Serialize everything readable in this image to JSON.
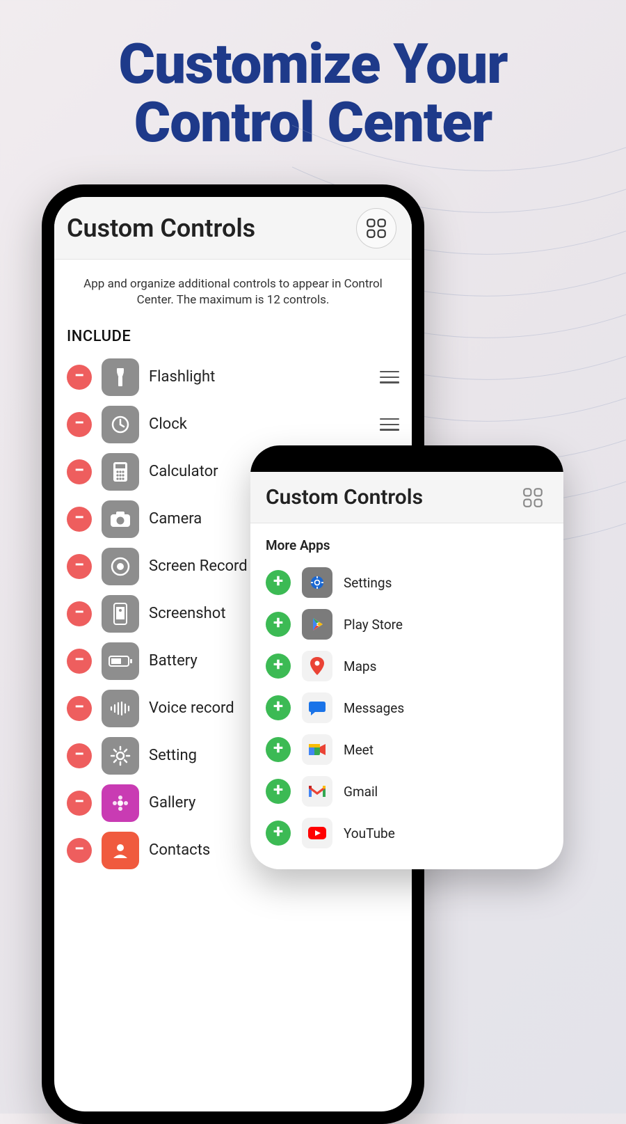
{
  "headline_line1": "Customize Your",
  "headline_line2": "Control Center",
  "phone": {
    "title": "Custom Controls",
    "description": "App and organize additional controls to appear in Control Center. The maximum is 12 controls.",
    "include_label": "INCLUDE",
    "items": [
      {
        "label": "Flashlight",
        "icon": "flashlight-icon"
      },
      {
        "label": "Clock",
        "icon": "clock-icon"
      },
      {
        "label": "Calculator",
        "icon": "calculator-icon"
      },
      {
        "label": "Camera",
        "icon": "camera-icon"
      },
      {
        "label": "Screen Record",
        "icon": "screen-record-icon"
      },
      {
        "label": "Screenshot",
        "icon": "screenshot-icon"
      },
      {
        "label": "Battery",
        "icon": "battery-icon"
      },
      {
        "label": "Voice record",
        "icon": "voice-record-icon"
      },
      {
        "label": "Setting",
        "icon": "settings-gear-icon"
      },
      {
        "label": "Gallery",
        "icon": "gallery-icon"
      },
      {
        "label": "Contacts",
        "icon": "contacts-icon"
      }
    ]
  },
  "card": {
    "title": "Custom Controls",
    "section": "More Apps",
    "items": [
      {
        "label": "Settings",
        "icon": "settings-app-icon"
      },
      {
        "label": "Play Store",
        "icon": "play-store-icon"
      },
      {
        "label": "Maps",
        "icon": "maps-icon"
      },
      {
        "label": "Messages",
        "icon": "messages-icon"
      },
      {
        "label": "Meet",
        "icon": "meet-icon"
      },
      {
        "label": "Gmail",
        "icon": "gmail-icon"
      },
      {
        "label": "YouTube",
        "icon": "youtube-icon"
      }
    ]
  },
  "colors": {
    "headline": "#1e3a8a",
    "remove_btn": "#ee5e5e",
    "add_btn": "#3cba54",
    "icon_bg": "#8e8e8e"
  }
}
